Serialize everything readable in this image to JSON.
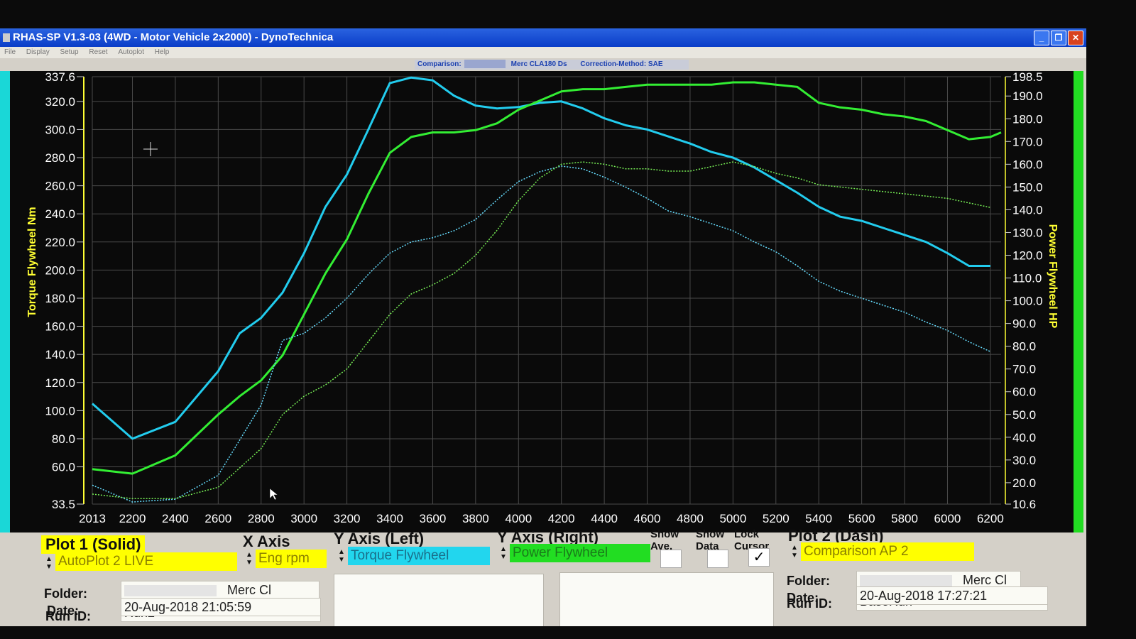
{
  "window": {
    "title": "RHAS-SP V1.3-03  (4WD - Motor Vehicle 2x2000) - DynoTechnica",
    "controls": [
      "_",
      "❐",
      "✕"
    ]
  },
  "menu": [
    "File",
    "Display",
    "Setup",
    "Reset",
    "Autoplot",
    "Help"
  ],
  "comparison_bar": {
    "comparison_label": "Comparison:",
    "comparison_name": "Merc CLA180 Ds",
    "correction": "Correction-Method: SAE"
  },
  "chart_data": {
    "type": "line",
    "xlabel": "",
    "ylabel_left": "Torque Flywheel Nm",
    "ylabel_right": "Power Flywheel HP",
    "xlim": [
      2013,
      6250
    ],
    "ylim_left": [
      33.5,
      337.6
    ],
    "ylim_right": [
      10.6,
      198.5
    ],
    "x_ticks": [
      "2013",
      "2200",
      "2400",
      "2600",
      "2800",
      "3000",
      "3200",
      "3400",
      "3600",
      "3800",
      "4000",
      "4200",
      "4400",
      "4600",
      "4800",
      "5000",
      "5200",
      "5400",
      "5600",
      "5800",
      "6000",
      "6200"
    ],
    "y_left_ticks": [
      "337.6",
      "320.0",
      "300.0",
      "280.0",
      "260.0",
      "240.0",
      "220.0",
      "200.0",
      "180.0",
      "160.0",
      "140.0",
      "120.0",
      "100.0",
      "80.0",
      "60.0",
      "33.5"
    ],
    "y_right_ticks": [
      "198.5",
      "190.0",
      "180.0",
      "170.0",
      "160.0",
      "150.0",
      "140.0",
      "130.0",
      "120.0",
      "110.0",
      "100.0",
      "90.0",
      "80.0",
      "70.0",
      "60.0",
      "50.0",
      "40.0",
      "30.0",
      "20.0",
      "10.6"
    ],
    "grid": true,
    "series": [
      {
        "name": "Torque Flywheel",
        "axis": "left",
        "style": "solid",
        "color": "#22ccee",
        "x": [
          2013,
          2200,
          2400,
          2600,
          2700,
          2800,
          2900,
          3000,
          3100,
          3200,
          3300,
          3400,
          3500,
          3600,
          3700,
          3800,
          3900,
          4000,
          4100,
          4200,
          4300,
          4400,
          4500,
          4600,
          4700,
          4800,
          4900,
          5000,
          5100,
          5200,
          5300,
          5400,
          5500,
          5600,
          5700,
          5800,
          5900,
          6000,
          6100,
          6200
        ],
        "y": [
          105,
          80,
          92,
          128,
          155,
          166,
          184,
          212,
          245,
          268,
          300,
          333,
          337,
          335,
          324,
          317,
          315,
          316,
          319,
          320,
          315,
          308,
          303,
          300,
          295,
          290,
          284,
          280,
          273,
          264,
          255,
          245,
          238,
          235,
          230,
          225,
          220,
          212,
          203,
          203
        ]
      },
      {
        "name": "Power Flywheel",
        "axis": "right",
        "style": "solid",
        "color": "#33ee33",
        "x": [
          2013,
          2200,
          2400,
          2600,
          2700,
          2800,
          2900,
          3000,
          3100,
          3200,
          3300,
          3400,
          3500,
          3600,
          3700,
          3800,
          3900,
          4000,
          4100,
          4200,
          4300,
          4400,
          4500,
          4600,
          4700,
          4800,
          4900,
          5000,
          5100,
          5200,
          5300,
          5400,
          5500,
          5600,
          5700,
          5800,
          5900,
          6000,
          6100,
          6200,
          6250
        ],
        "y": [
          26,
          24,
          32,
          50,
          58,
          65,
          76,
          94,
          112,
          127,
          147,
          165,
          172,
          174,
          174,
          175,
          178,
          184,
          188,
          192,
          193,
          193,
          194,
          195,
          195,
          195,
          195,
          196,
          196,
          195,
          194,
          187,
          185,
          184,
          182,
          181,
          179,
          175,
          171,
          172,
          174
        ]
      },
      {
        "name": "Torque Flywheel (Comparison)",
        "axis": "left",
        "style": "dashed",
        "color": "#66ddff",
        "x": [
          2013,
          2200,
          2400,
          2600,
          2800,
          2900,
          3000,
          3100,
          3200,
          3300,
          3400,
          3500,
          3600,
          3700,
          3800,
          3900,
          4000,
          4100,
          4200,
          4300,
          4400,
          4500,
          4600,
          4700,
          4800,
          4900,
          5000,
          5100,
          5200,
          5300,
          5400,
          5500,
          5600,
          5700,
          5800,
          5900,
          6000,
          6100,
          6200
        ],
        "y": [
          47,
          35,
          37,
          54,
          104,
          150,
          155,
          166,
          180,
          197,
          212,
          220,
          223,
          228,
          236,
          250,
          263,
          270,
          274,
          272,
          266,
          259,
          251,
          242,
          238,
          233,
          228,
          220,
          213,
          203,
          192,
          185,
          180,
          175,
          170,
          163,
          157,
          149,
          142
        ]
      },
      {
        "name": "Power Flywheel (Comparison)",
        "axis": "right",
        "style": "dashed",
        "color": "#77ee55",
        "x": [
          2013,
          2200,
          2400,
          2600,
          2800,
          2900,
          3000,
          3100,
          3200,
          3300,
          3400,
          3500,
          3600,
          3700,
          3800,
          3900,
          4000,
          4100,
          4200,
          4300,
          4400,
          4500,
          4600,
          4700,
          4800,
          4900,
          5000,
          5100,
          5200,
          5300,
          5400,
          5500,
          5600,
          5700,
          5800,
          5900,
          6000,
          6100,
          6200
        ],
        "y": [
          15,
          13,
          13,
          18,
          35,
          50,
          58,
          63,
          70,
          82,
          94,
          103,
          107,
          112,
          120,
          131,
          144,
          154,
          160,
          161,
          160,
          158,
          158,
          157,
          157,
          159,
          161,
          159,
          156,
          154,
          151,
          150,
          149,
          148,
          147,
          146,
          145,
          143,
          141
        ]
      }
    ]
  },
  "controls": {
    "plot1_header": "Plot 1 (Solid)",
    "x_axis_header": "X Axis",
    "y_left_header": "Y Axis (Left)",
    "y_right_header": "Y Axis (Right)",
    "show_ave_label": "Show Ave.",
    "show_data_label": "Show Data",
    "lock_cursor_label": "Lock Cursor",
    "plot2_header": "Plot 2 (Dash)",
    "plot1_select": "AutoPlot 2 LIVE",
    "x_axis_select": "Eng rpm",
    "y_left_select": "Torque Flywheel",
    "y_right_select": "Power Flywheel",
    "plot2_select": "Comparison AP 2",
    "lock_cursor_mark": "✓",
    "plot1": {
      "folder_label": "Folder:",
      "folder": "Merc Cl",
      "run_id_label": "Run ID:",
      "run_id": "Run2",
      "date_label": "Date:",
      "date": "20-Aug-2018  21:05:59"
    },
    "plot2": {
      "folder_label": "Folder:",
      "folder": "Merc Cl",
      "run_id_label": "Run ID:",
      "run_id": "BaseRun",
      "date_label": "Date:",
      "date": "20-Aug-2018  17:27:21"
    }
  }
}
